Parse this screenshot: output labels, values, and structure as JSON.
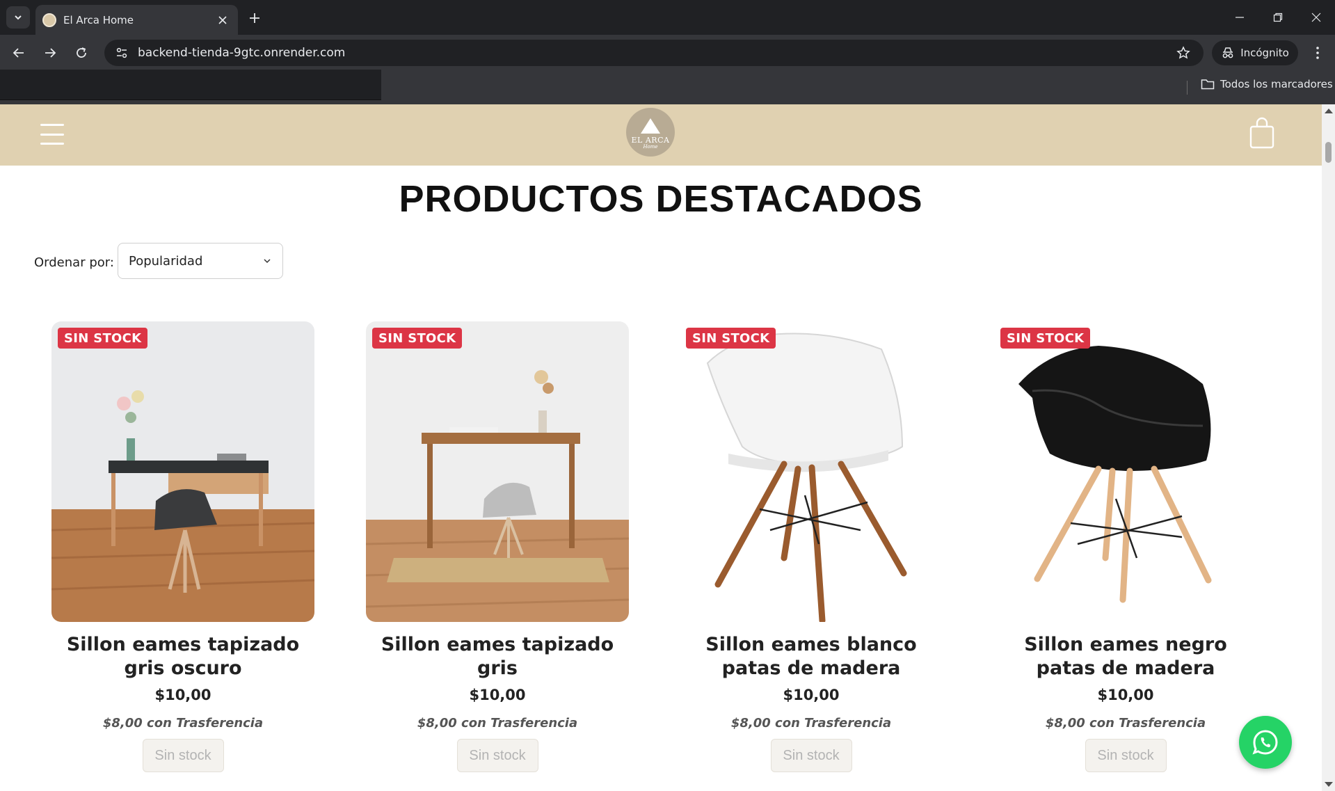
{
  "browser": {
    "tab_title": "El Arca Home",
    "url": "backend-tienda-9gtc.onrender.com",
    "incognito_label": "Incógnito",
    "bookmarks_all_label": "Todos los marcadores"
  },
  "site": {
    "logo_text": "EL ARCA",
    "logo_subtext": "Home"
  },
  "main": {
    "title": "PRODUCTOS DESTACADOS",
    "sort_label": "Ordenar por:",
    "sort_value": "Popularidad"
  },
  "products": [
    {
      "badge": "SIN STOCK",
      "name": "Sillon eames tapizado gris oscuro",
      "price": "$10,00",
      "transfer_price": "$8,00 con Trasferencia",
      "button_label": "Sin stock"
    },
    {
      "badge": "SIN STOCK",
      "name": "Sillon eames tapizado gris",
      "price": "$10,00",
      "transfer_price": "$8,00 con Trasferencia",
      "button_label": "Sin stock"
    },
    {
      "badge": "SIN STOCK",
      "name": "Sillon eames blanco patas de madera",
      "price": "$10,00",
      "transfer_price": "$8,00 con Trasferencia",
      "button_label": "Sin stock"
    },
    {
      "badge": "SIN STOCK",
      "name": "Sillon eames negro patas de madera",
      "price": "$10,00",
      "transfer_price": "$8,00 con Trasferencia",
      "button_label": "Sin stock"
    }
  ],
  "colors": {
    "header_bg": "#e0d1b1",
    "badge_bg": "#dc3545",
    "whatsapp": "#25d366"
  },
  "icons": [
    "tab-search-icon",
    "close-icon",
    "plus-icon",
    "minimize-icon",
    "restore-icon",
    "back-icon",
    "forward-icon",
    "reload-icon",
    "site-info-icon",
    "star-icon",
    "incognito-icon",
    "menu-icon",
    "folder-icon",
    "hamburger-icon",
    "shopping-bag-icon",
    "chevron-down-icon",
    "whatsapp-icon"
  ]
}
